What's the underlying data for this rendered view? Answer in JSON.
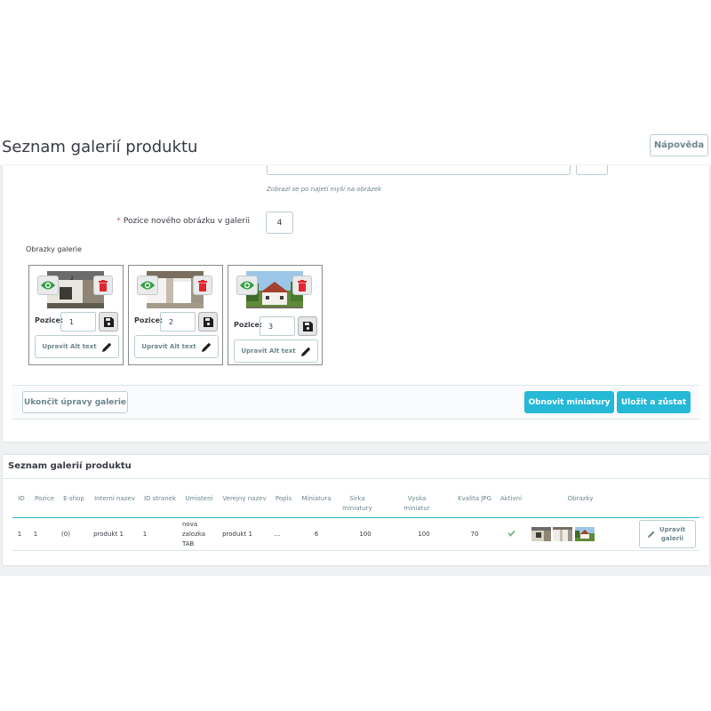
{
  "header": {
    "title": "Seznam galerií produktu",
    "help_label": "Nápověda"
  },
  "form": {
    "hint": "Zobrazí se po najetí myší na obrázek",
    "required_mark": "*",
    "new_pos_label": "Pozice nového obrázku v galerii",
    "new_pos_value": "4",
    "gallery_images_label": "Obrazky galerie",
    "images": [
      {
        "position_label": "Pozice:",
        "position": "1",
        "alt_label": "Upravit Alt text"
      },
      {
        "position_label": "Pozice:",
        "position": "2",
        "alt_label": "Upravit Alt text"
      },
      {
        "position_label": "Pozice:",
        "position": "3",
        "alt_label": "Upravit Alt text"
      }
    ],
    "buttons": {
      "finish": "Ukončit úpravy galerie",
      "refresh": "Obnovit miniatury",
      "save_stay": "Uložit a zůstat"
    }
  },
  "list": {
    "title": "Seznam galerií produktu",
    "columns": [
      "ID",
      "Pozice",
      "E-shop",
      "Interni nazev",
      "ID stranek",
      "Umisteni",
      "Verejny nazev",
      "Popis",
      "Miniatura",
      "Sirka miniatury",
      "Vyska miniatur",
      "Kvalita JPG",
      "Aktivni",
      "Obrazky"
    ],
    "rows": [
      {
        "id": "1",
        "position": "1",
        "shop": "(0)",
        "internal_name": "produkt 1",
        "page_ids": "1",
        "placement": "nova zalozka TAB",
        "public_name": "produkt 1",
        "description": "...",
        "thumbnail": "6",
        "thumb_width": "100",
        "thumb_height": "100",
        "jpg_quality": "70",
        "active": "check-icon",
        "edit_label": "Upravit galerii"
      }
    ]
  },
  "colors": {
    "primary": "#25b9d7",
    "eye": "#2e9e3e",
    "trash": "#e0262b",
    "check": "#70b580"
  }
}
